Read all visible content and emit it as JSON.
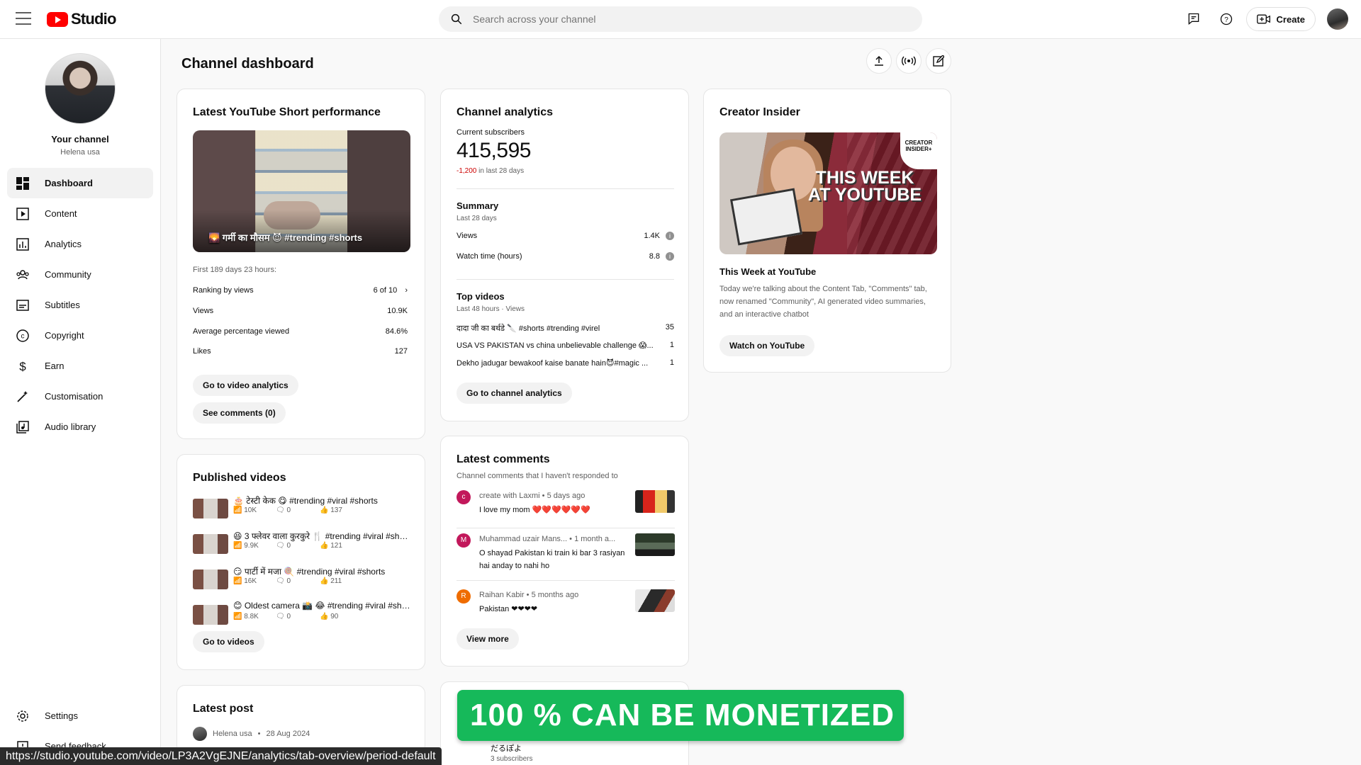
{
  "app": {
    "name": "Studio"
  },
  "search": {
    "placeholder": "Search across your channel"
  },
  "topbar": {
    "create_label": "Create"
  },
  "profile": {
    "title": "Your channel",
    "name": "Helena usa"
  },
  "sidebar": {
    "items": [
      {
        "label": "Dashboard",
        "icon": "dashboard-icon",
        "active": true
      },
      {
        "label": "Content",
        "icon": "content-icon"
      },
      {
        "label": "Analytics",
        "icon": "analytics-icon"
      },
      {
        "label": "Community",
        "icon": "community-icon"
      },
      {
        "label": "Subtitles",
        "icon": "subtitles-icon"
      },
      {
        "label": "Copyright",
        "icon": "copyright-icon"
      },
      {
        "label": "Earn",
        "icon": "earn-icon"
      },
      {
        "label": "Customisation",
        "icon": "customisation-icon"
      },
      {
        "label": "Audio library",
        "icon": "audio-library-icon"
      }
    ],
    "bottom": [
      {
        "label": "Settings",
        "icon": "settings-icon"
      },
      {
        "label": "Send feedback",
        "icon": "feedback-icon"
      }
    ]
  },
  "page": {
    "title": "Channel dashboard"
  },
  "short_card": {
    "title": "Latest YouTube Short performance",
    "caption": "🌄 गर्मी का मौसम 😈 #trending #shorts",
    "period": "First 189 days 23 hours:",
    "ranking_label": "Ranking by views",
    "ranking_value": "6 of 10",
    "stats": [
      {
        "label": "Views",
        "value": "10.9K"
      },
      {
        "label": "Average percentage viewed",
        "value": "84.6%"
      },
      {
        "label": "Likes",
        "value": "127"
      }
    ],
    "btn_analytics": "Go to video analytics",
    "btn_comments": "See comments (0)"
  },
  "analytics_card": {
    "title": "Channel analytics",
    "subs_label": "Current subscribers",
    "subs_value": "415,595",
    "subs_change": "-1,200",
    "subs_change_suffix": "in last 28 days",
    "summary_title": "Summary",
    "summary_period": "Last 28 days",
    "summary": [
      {
        "label": "Views",
        "value": "1.4K"
      },
      {
        "label": "Watch time (hours)",
        "value": "8.8"
      }
    ],
    "top_title": "Top videos",
    "top_period": "Last 48 hours · Views",
    "top_videos": [
      {
        "title": "दादा जी का बर्थडे 🔪 #shorts #trending #virel",
        "views": "35"
      },
      {
        "title": "USA VS PAKISTAN vs china unbelievable challenge 😱...",
        "views": "1"
      },
      {
        "title": "Dekho jadugar bewakoof kaise banate hain😈#magic ...",
        "views": "1"
      }
    ],
    "btn": "Go to channel analytics"
  },
  "insider_card": {
    "title": "Creator Insider",
    "thumb_text": "THIS WEEK AT YOUTUBE",
    "badge": "CREATOR INSIDER+",
    "video_title": "This Week at YouTube",
    "description": "Today we're talking about the Content Tab, \"Comments\" tab, now renamed \"Community\", AI generated video summaries, and an interactive chatbot",
    "btn": "Watch on YouTube"
  },
  "published_card": {
    "title": "Published videos",
    "videos": [
      {
        "title": "🎂 टेस्टी केक 😋 #trending #viral #shorts",
        "views": "10K",
        "comments": "0",
        "likes": "137"
      },
      {
        "title": "😆 3 फ्लेवर वाला कुरकुरे 🍴 #trending #viral #shorts",
        "views": "9.9K",
        "comments": "0",
        "likes": "121"
      },
      {
        "title": "😏 पार्टी में मजा 🍭 #trending #viral #shorts",
        "views": "16K",
        "comments": "0",
        "likes": "211"
      },
      {
        "title": "😊 Oldest camera 📸 😂 #trending #viral #shorts",
        "views": "8.8K",
        "comments": "0",
        "likes": "90"
      }
    ],
    "btn": "Go to videos"
  },
  "comments_card": {
    "title": "Latest comments",
    "subtitle": "Channel comments that I haven't responded to",
    "comments": [
      {
        "initial": "c",
        "color": "#c2185b",
        "author": "create with Laxmi",
        "time": "5 days ago",
        "text": "I love my mom ❤️❤️❤️❤️❤️❤️"
      },
      {
        "initial": "M",
        "color": "#c2185b",
        "author": "Muhammad uzair Mans...",
        "time": "1 month a...",
        "text": "O shayad Pakistan ki train ki bar 3 rasiyan hai anday to nahi ho"
      },
      {
        "initial": "R",
        "color": "#ef6c00",
        "author": "Raihan Kabir",
        "time": "5 months ago",
        "text": "Pakistan ❤❤❤❤"
      }
    ],
    "btn": "View more"
  },
  "latest_post": {
    "title": "Latest post",
    "author": "Helena usa",
    "date": "28 Aug 2024"
  },
  "subscriber_peek": {
    "name": "だるぽよ",
    "count": "3 subscribers"
  },
  "banner": {
    "text": "100 % CAN BE MONETIZED"
  },
  "status_url": "https://studio.youtube.com/video/LP3A2VgEJNE/analytics/tab-overview/period-default"
}
